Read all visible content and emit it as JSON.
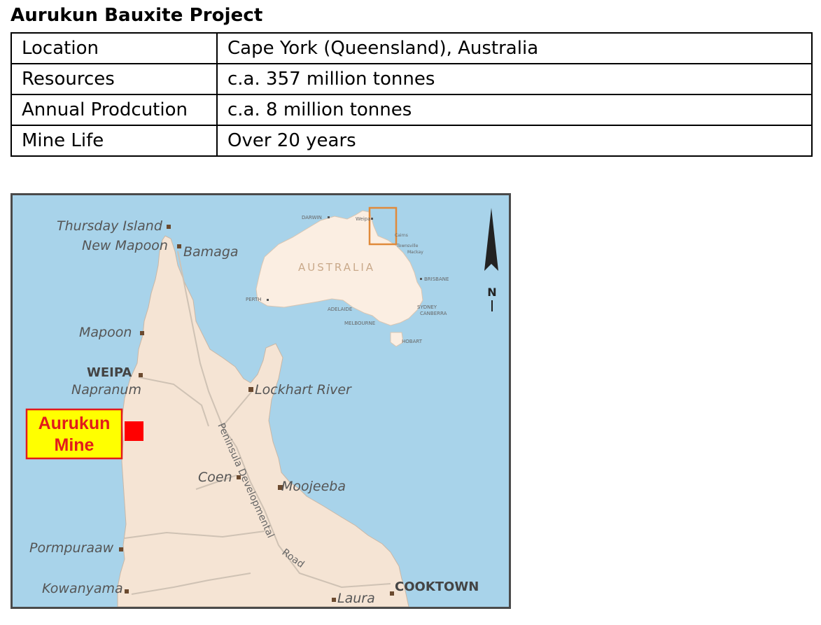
{
  "title": "Aurukun Bauxite Project",
  "table": {
    "rows": [
      {
        "label": "Location",
        "value": "Cape York (Queensland), Australia"
      },
      {
        "label": "Resources",
        "value": "c.a. 357 million tonnes"
      },
      {
        "label": "Annual Prodcution",
        "value": "c.a. 8 million tonnes"
      },
      {
        "label": "Mine Life",
        "value": "Over 20 years"
      }
    ]
  },
  "map": {
    "places": {
      "thursday_island": "Thursday Island",
      "new_mapoon": "New Mapoon",
      "bamaga": "Bamaga",
      "mapoon": "Mapoon",
      "weipa": "WEIPA",
      "napranum": "Napranum",
      "lockhart_river": "Lockhart River",
      "coen": "Coen",
      "moojeeba": "Moojeeba",
      "pormpuraaw": "Pormpuraaw",
      "kowanyama": "Kowanyama",
      "laura": "Laura",
      "cooktown": "COOKTOWN"
    },
    "road_label_1": "Peninsula Developmental",
    "road_label_2": "Road",
    "mine_label_line1": "Aurukun",
    "mine_label_line2": "Mine",
    "mine_color": "#ff0000",
    "mine_box_color": "#ffff00",
    "north_label": "N",
    "inset": {
      "country": "AUSTRALIA",
      "darwin": "DARWIN",
      "weipa": "Weipa",
      "cairns": "Cairns",
      "townsville": "Townsville",
      "mackay": "Mackay",
      "brisbane": "BRISBANE",
      "sydney": "SYDNEY",
      "canberra": "CANBERRA",
      "melbourne": "MELBOURNE",
      "adelaide": "ADELAIDE",
      "perth": "PERTH",
      "hobart": "HOBART"
    }
  }
}
